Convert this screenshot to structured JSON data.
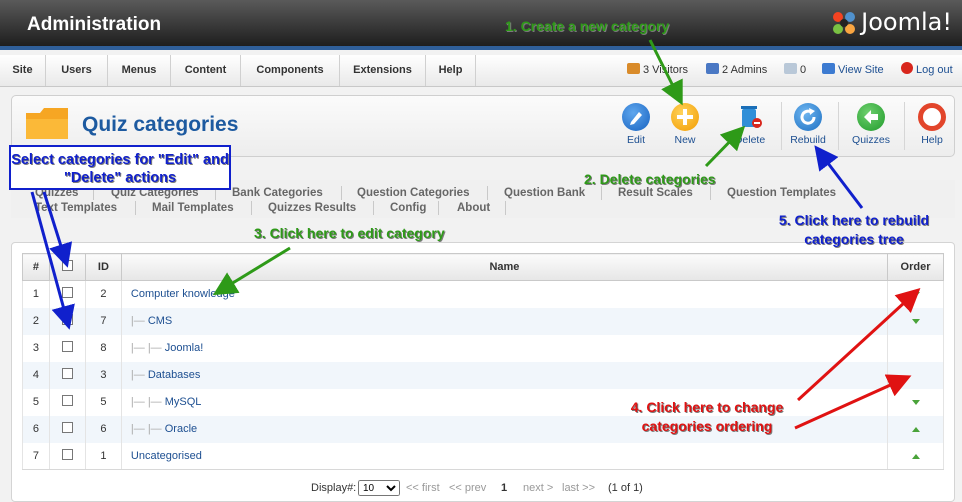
{
  "header": {
    "title": "Administration",
    "logo_text": "Joomla!"
  },
  "menu": {
    "items": [
      "Site",
      "Users",
      "Menus",
      "Content",
      "Components",
      "Extensions",
      "Help"
    ],
    "status": {
      "visitors": "3 Visitors",
      "admins": "2 Admins",
      "messages": "0",
      "view_site": "View Site",
      "logout": "Log out"
    }
  },
  "toolbar": {
    "title": "Quiz categories",
    "buttons": [
      {
        "label": "Edit",
        "icon": "pencil-icon"
      },
      {
        "label": "New",
        "icon": "plus-icon"
      },
      {
        "label": "Delete",
        "icon": "trash-icon"
      },
      {
        "label": "Rebuild",
        "icon": "refresh-icon"
      },
      {
        "label": "Quizzes",
        "icon": "back-arrow-icon"
      },
      {
        "label": "Help",
        "icon": "lifebuoy-icon"
      }
    ]
  },
  "submenu": {
    "row1": [
      "Quizzes",
      "Quiz Categories",
      "Bank Categories",
      "Question Categories",
      "Question Bank",
      "Result Scales",
      "Question Templates"
    ],
    "row2": [
      "Text Templates",
      "Mail Templates",
      "Quizzes Results",
      "Config",
      "About"
    ]
  },
  "table": {
    "headers": {
      "num": "#",
      "id": "ID",
      "name": "Name",
      "order": "Order"
    },
    "rows": [
      {
        "num": "1",
        "id": "2",
        "prefix": "",
        "name": "Computer knowledge",
        "order": "down"
      },
      {
        "num": "2",
        "id": "7",
        "prefix": "|— ",
        "name": "CMS",
        "order": "down"
      },
      {
        "num": "3",
        "id": "8",
        "prefix": "|— |— ",
        "name": "Joomla!",
        "order": ""
      },
      {
        "num": "4",
        "id": "3",
        "prefix": "|— ",
        "name": "Databases",
        "order": ""
      },
      {
        "num": "5",
        "id": "5",
        "prefix": "|— |— ",
        "name": "MySQL",
        "order": "down"
      },
      {
        "num": "6",
        "id": "6",
        "prefix": "|— |— ",
        "name": "Oracle",
        "order": "up"
      },
      {
        "num": "7",
        "id": "1",
        "prefix": "",
        "name": "Uncategorised",
        "order": "up"
      }
    ]
  },
  "pagination": {
    "display_label": "Display#:",
    "display_value": "10",
    "first": "<< first",
    "prev": "<< prev",
    "current": "1",
    "next": "next >",
    "last": "last >>",
    "info": "(1 of 1)"
  },
  "annotations": {
    "create": "1. Create a new category",
    "delete": "2. Delete categories",
    "edit": "3. Click here to edit category",
    "ordering": "4. Click here to change categories ordering",
    "rebuild": "5. Click here to rebuild categories tree",
    "select": "Select categories for \"Edit\" and \"Delete\" actions"
  },
  "colors": {
    "link": "#1d4f91",
    "title": "#1d5aa0",
    "annotation_green": "#2e9a18",
    "annotation_blue": "#1020cc",
    "annotation_red": "#e01212"
  }
}
